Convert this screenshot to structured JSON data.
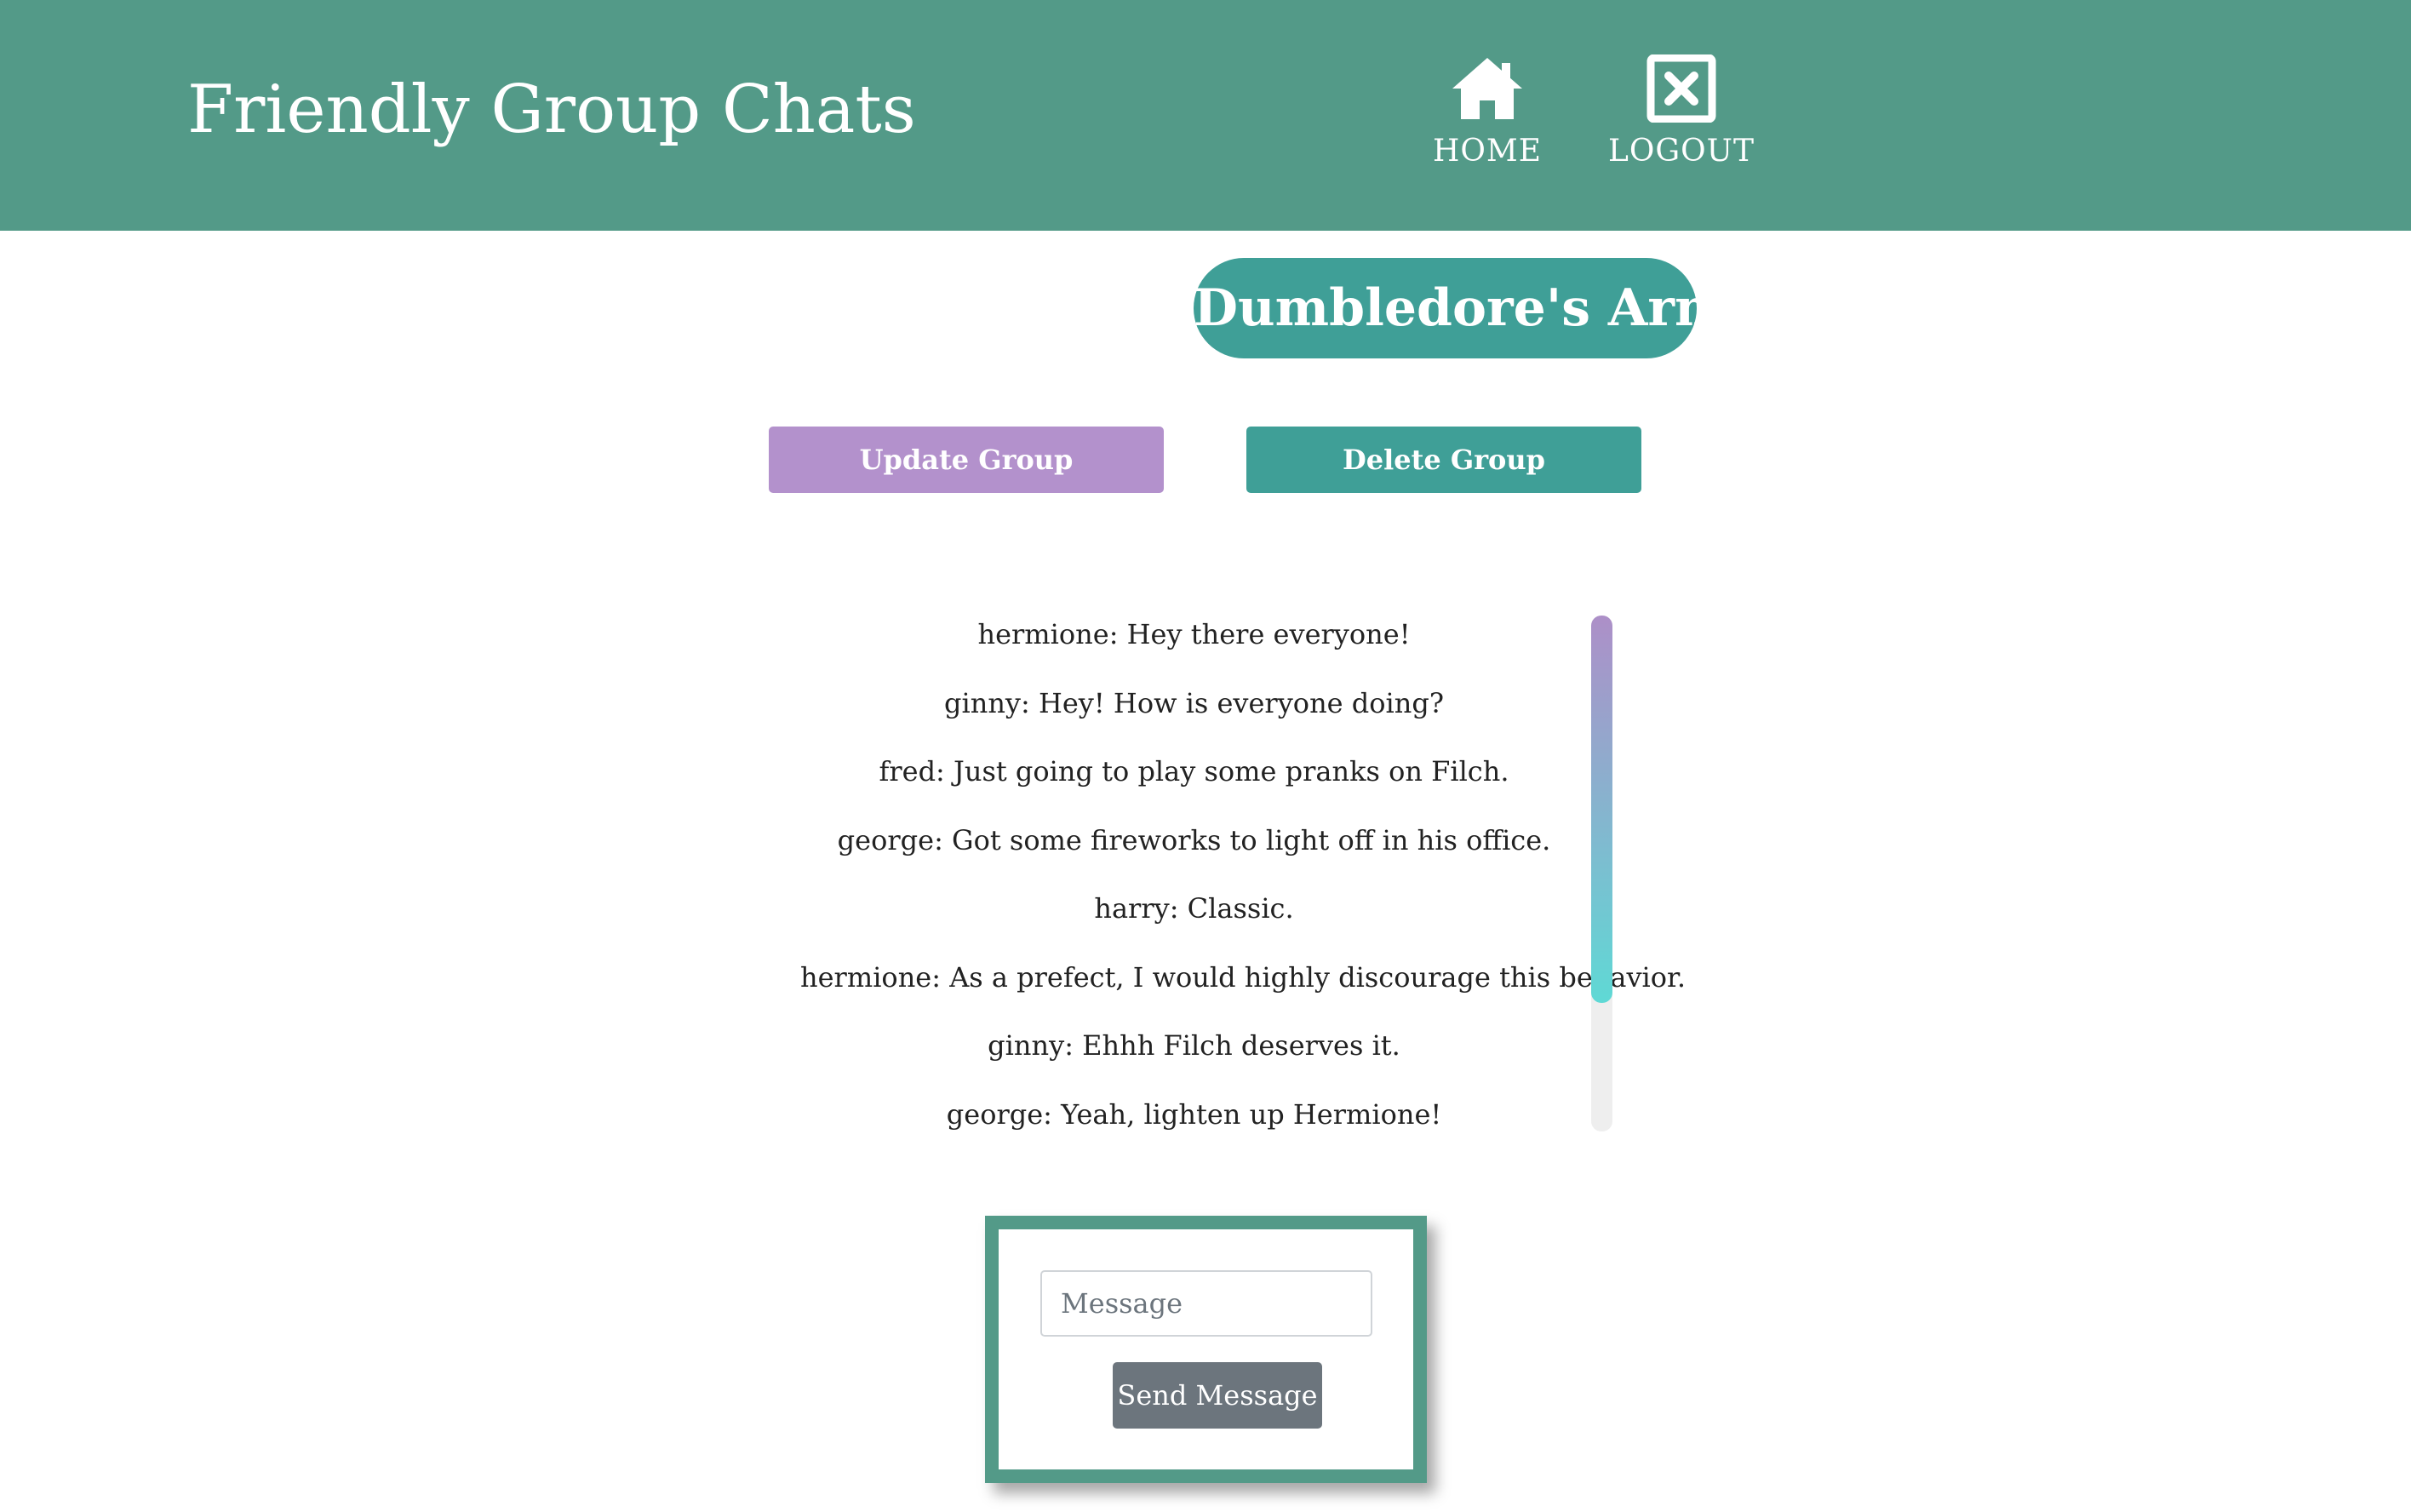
{
  "header": {
    "brand": "Friendly Group Chats",
    "nav": [
      {
        "label": "HOME",
        "icon": "home-icon"
      },
      {
        "label": "LOGOUT",
        "icon": "close-square-icon"
      }
    ]
  },
  "group": {
    "title": "Dumbledore's Army",
    "update_label": "Update Group",
    "delete_label": "Delete Group"
  },
  "messages": [
    {
      "author": "hermione",
      "text": "Hey there everyone!"
    },
    {
      "author": "ginny",
      "text": "Hey! How is everyone doing?"
    },
    {
      "author": "fred",
      "text": "Just going to play some pranks on Filch."
    },
    {
      "author": "george",
      "text": "Got some fireworks to light off in his office."
    },
    {
      "author": "harry",
      "text": "Classic."
    },
    {
      "author": "hermione",
      "text": "As a prefect, I would highly discourage this behavior."
    },
    {
      "author": "ginny",
      "text": "Ehhh Filch deserves it."
    },
    {
      "author": "george",
      "text": "Yeah, lighten up Hermione!"
    }
  ],
  "scroll": {
    "visible_fraction": 0.75,
    "position_fraction": 0.0
  },
  "composer": {
    "placeholder": "Message",
    "value": "",
    "send_label": "Send Message"
  },
  "colors": {
    "header": "#539a88",
    "accent_teal": "#3f9f97",
    "accent_purple": "#b391cc",
    "send_button": "#6c757d"
  }
}
